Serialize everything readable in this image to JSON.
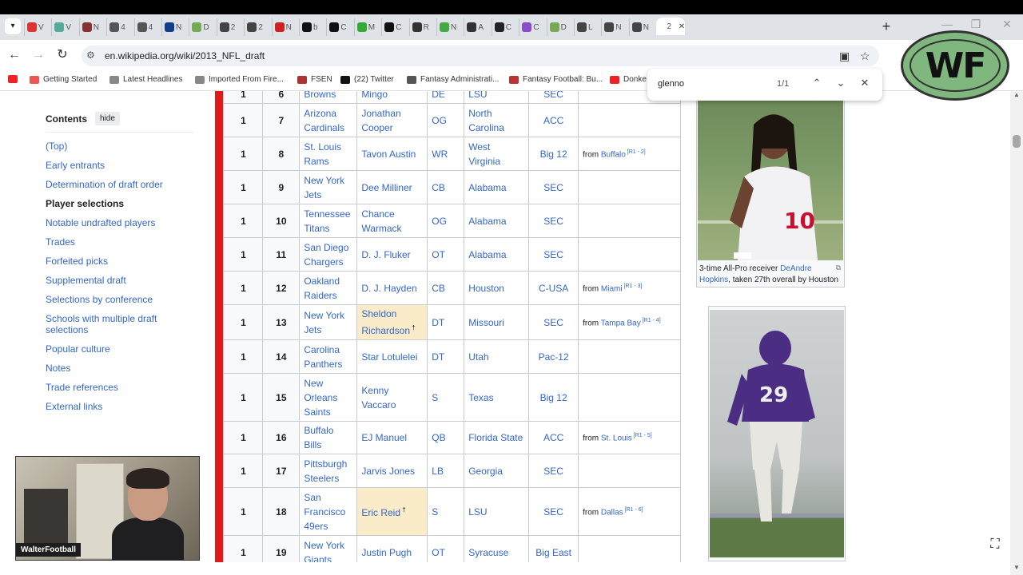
{
  "browser": {
    "tabs": [
      {
        "icon": "youtube",
        "text": "V",
        "color": "#d33"
      },
      {
        "icon": "monitor",
        "text": "V",
        "color": "#5a9"
      },
      {
        "icon": "circle",
        "text": "N",
        "color": "#833"
      },
      {
        "icon": "globe",
        "text": "4",
        "color": "#555"
      },
      {
        "icon": "globe",
        "text": "4",
        "color": "#555"
      },
      {
        "icon": "shield",
        "text": "N",
        "color": "#123e8a"
      },
      {
        "icon": "helmet",
        "text": "D",
        "color": "#7a5"
      },
      {
        "icon": "dash",
        "text": "2",
        "color": "#444"
      },
      {
        "icon": "dash",
        "text": "2",
        "color": "#444"
      },
      {
        "icon": "tc",
        "text": "N",
        "color": "#c22"
      },
      {
        "icon": "x",
        "text": "b",
        "color": "#111"
      },
      {
        "icon": "hat",
        "text": "C",
        "color": "#111"
      },
      {
        "icon": "square",
        "text": "M",
        "color": "#3a3"
      },
      {
        "icon": "hat",
        "text": "C",
        "color": "#111"
      },
      {
        "icon": "circle",
        "text": "R",
        "color": "#333"
      },
      {
        "icon": "plus",
        "text": "N",
        "color": "#4a4"
      },
      {
        "icon": "wiki",
        "text": "A",
        "color": "#333"
      },
      {
        "icon": "circle",
        "text": "C",
        "color": "#222"
      },
      {
        "icon": "chat",
        "text": "C",
        "color": "#8a4cc8"
      },
      {
        "icon": "helmet",
        "text": "D",
        "color": "#7a5"
      },
      {
        "icon": "dash",
        "text": "L",
        "color": "#444"
      },
      {
        "icon": "dash",
        "text": "N",
        "color": "#444"
      },
      {
        "icon": "dash",
        "text": "N",
        "color": "#444"
      },
      {
        "icon": "active",
        "text": "2",
        "color": "#444"
      }
    ],
    "url": "en.wikipedia.org/wiki/2013_NFL_draft",
    "bookmarks": [
      {
        "label": "",
        "color": "#e22"
      },
      {
        "label": "Getting Started",
        "color": "#e55"
      },
      {
        "label": "Latest Headlines",
        "color": "#888"
      },
      {
        "label": "Imported From Fire...",
        "color": "#888"
      },
      {
        "label": "FSEN",
        "color": "#a33"
      },
      {
        "label": "(22) Twitter",
        "color": "#111"
      },
      {
        "label": "Fantasy Administrati...",
        "color": "#555"
      },
      {
        "label": "Fantasy Football: Bu...",
        "color": "#b33"
      },
      {
        "label": "Donke",
        "color": "#e22"
      }
    ],
    "find": {
      "query": "glenno",
      "count": "1/1"
    }
  },
  "toc": {
    "title": "Contents",
    "hide_label": "hide",
    "items": [
      "(Top)",
      "Early entrants",
      "Determination of draft order",
      "Player selections",
      "Notable undrafted players",
      "Trades",
      "Forfeited picks",
      "Supplemental draft",
      "Selections by conference",
      "Schools with multiple draft selections",
      "Popular culture",
      "Notes",
      "Trade references",
      "External links"
    ],
    "current_index": 3
  },
  "table": {
    "rows": [
      {
        "rnd": "1",
        "pick": "6",
        "team": "Browns",
        "player": "Mingo",
        "pos": "DE",
        "college": "LSU",
        "conf": "SEC",
        "notes": "",
        "pro": false,
        "partial": true
      },
      {
        "rnd": "1",
        "pick": "7",
        "team": "Arizona Cardinals",
        "player": "Jonathan Cooper",
        "pos": "OG",
        "college": "North Carolina",
        "conf": "ACC",
        "notes": "",
        "pro": false
      },
      {
        "rnd": "1",
        "pick": "8",
        "team": "St. Louis Rams",
        "player": "Tavon Austin",
        "pos": "WR",
        "college": "West Virginia",
        "conf": "Big 12",
        "notes": "from Buffalo",
        "ref": "[R1 - 2]",
        "pro": false
      },
      {
        "rnd": "1",
        "pick": "9",
        "team": "New York Jets",
        "player": "Dee Milliner",
        "pos": "CB",
        "college": "Alabama",
        "conf": "SEC",
        "notes": "",
        "pro": false
      },
      {
        "rnd": "1",
        "pick": "10",
        "team": "Tennessee Titans",
        "player": "Chance Warmack",
        "pos": "OG",
        "college": "Alabama",
        "conf": "SEC",
        "notes": "",
        "pro": false
      },
      {
        "rnd": "1",
        "pick": "11",
        "team": "San Diego Chargers",
        "player": "D. J. Fluker",
        "pos": "OT",
        "college": "Alabama",
        "conf": "SEC",
        "notes": "",
        "pro": false
      },
      {
        "rnd": "1",
        "pick": "12",
        "team": "Oakland Raiders",
        "player": "D. J. Hayden",
        "pos": "CB",
        "college": "Houston",
        "conf": "C-USA",
        "notes": "from Miami",
        "ref": "[R1 - 3]",
        "pro": false
      },
      {
        "rnd": "1",
        "pick": "13",
        "team": "New York Jets",
        "player": "Sheldon Richardson",
        "dagger": "†",
        "pos": "DT",
        "college": "Missouri",
        "conf": "SEC",
        "notes": "from Tampa Bay",
        "ref": "[R1 - 4]",
        "pro": true
      },
      {
        "rnd": "1",
        "pick": "14",
        "team": "Carolina Panthers",
        "player": "Star Lotulelei",
        "pos": "DT",
        "college": "Utah",
        "conf": "Pac-12",
        "notes": "",
        "pro": false
      },
      {
        "rnd": "1",
        "pick": "15",
        "team": "New Orleans Saints",
        "player": "Kenny Vaccaro",
        "pos": "S",
        "college": "Texas",
        "conf": "Big 12",
        "notes": "",
        "pro": false
      },
      {
        "rnd": "1",
        "pick": "16",
        "team": "Buffalo Bills",
        "player": "EJ Manuel",
        "pos": "QB",
        "college": "Florida State",
        "conf": "ACC",
        "notes": "from St. Louis",
        "ref": "[R1 - 5]",
        "pro": false
      },
      {
        "rnd": "1",
        "pick": "17",
        "team": "Pittsburgh Steelers",
        "player": "Jarvis Jones",
        "pos": "LB",
        "college": "Georgia",
        "conf": "SEC",
        "notes": "",
        "pro": false
      },
      {
        "rnd": "1",
        "pick": "18",
        "team": "San Francisco 49ers",
        "player": "Eric Reid",
        "dagger": "†",
        "pos": "S",
        "college": "LSU",
        "conf": "SEC",
        "notes": "from Dallas",
        "ref": "[R1 - 6]",
        "pro": true
      },
      {
        "rnd": "1",
        "pick": "19",
        "team": "New York Giants",
        "player": "Justin Pugh",
        "pos": "OT",
        "college": "Syracuse",
        "conf": "Big East",
        "notes": "",
        "pro": false
      }
    ]
  },
  "images": {
    "caption1_prefix": "3-time All-Pro receiver ",
    "caption1_link": "DeAndre Hopkins",
    "caption1_suffix": ", taken 27th overall by Houston",
    "jersey1": "10",
    "jersey2": "29"
  },
  "overlay": {
    "logo_text": "WF",
    "webcam_label": "WalterFootball"
  },
  "colors": {
    "accent_red": "#e01a1a",
    "link_blue": "#3366cc",
    "pro_bowl_bg": "#faecc8"
  }
}
